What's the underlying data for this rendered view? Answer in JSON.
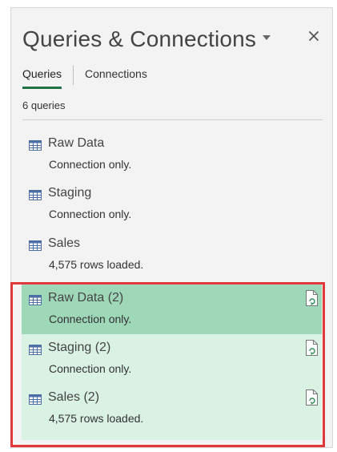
{
  "pane": {
    "title": "Queries & Connections",
    "dropdown_icon": "chevron-down-icon",
    "close_icon": "close-icon"
  },
  "tabs": [
    {
      "label": "Queries",
      "active": true
    },
    {
      "label": "Connections",
      "active": false
    }
  ],
  "query_count": "6 queries",
  "queries": [
    {
      "name": "Raw Data",
      "status": "Connection only.",
      "icon": "table-icon",
      "selected": false
    },
    {
      "name": "Staging",
      "status": "Connection only.",
      "icon": "table-icon",
      "selected": false
    },
    {
      "name": "Sales",
      "status": "4,575 rows loaded.",
      "icon": "table-icon",
      "selected": false
    },
    {
      "name": "Raw Data (2)",
      "status": "Connection only.",
      "icon": "table-icon",
      "selected": true,
      "refresh_icon": "refresh-document-icon"
    },
    {
      "name": "Staging (2)",
      "status": "Connection only.",
      "icon": "table-icon",
      "selected": true,
      "refresh_icon": "refresh-document-icon"
    },
    {
      "name": "Sales (2)",
      "status": "4,575 rows loaded.",
      "icon": "table-icon",
      "selected": true,
      "refresh_icon": "refresh-document-icon"
    }
  ],
  "colors": {
    "accent": "#217346",
    "selected_active": "#9fd8b8",
    "selected": "#d9f2e4",
    "highlight_border": "#e0383b"
  }
}
